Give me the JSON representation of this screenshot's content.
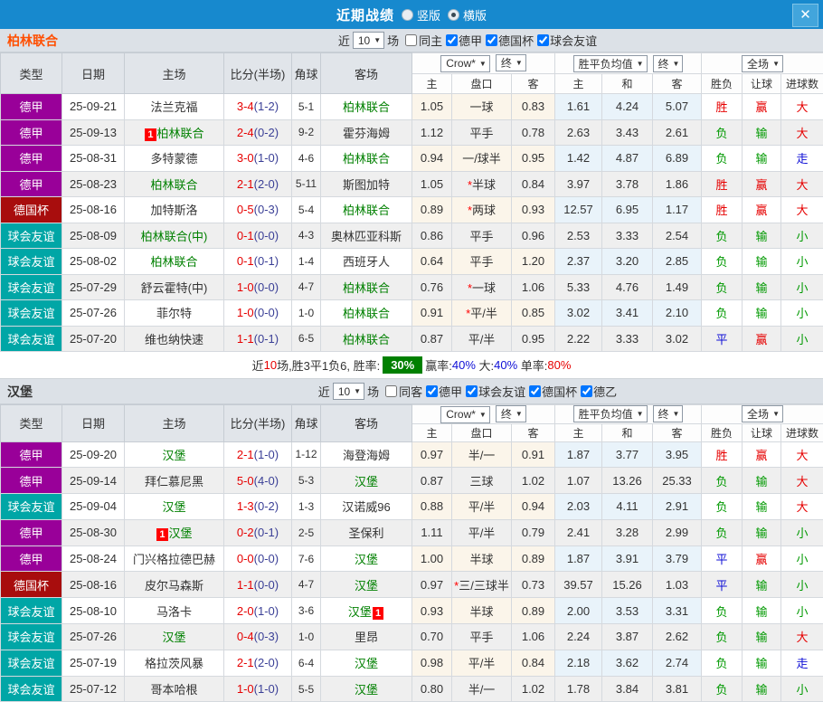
{
  "titlebar": {
    "title": "近期战绩",
    "radio_vertical": "竖版",
    "radio_horizontal": "横版",
    "selected": "横版",
    "close_glyph": "✕"
  },
  "colors": {
    "topbar_blue": "#1789CE",
    "win_red": "#E60000",
    "lose_green": "#009900",
    "draw_blue": "#0F0FD6",
    "winrate_badge_green": "#008000",
    "league_bundesliga": "#990099",
    "league_german_cup": "#A80D0D",
    "league_friendly": "#00A6A6",
    "team1_accent": "#FF4E00"
  },
  "headers": {
    "type": "类型",
    "date": "日期",
    "home": "主场",
    "score": "比分(半场)",
    "corner": "角球",
    "away": "客场",
    "odds_company": "Crow*",
    "final1": "终",
    "avg_label": "胜平负均值",
    "final2": "终",
    "scope": "全场",
    "sub": [
      "主",
      "盘口",
      "客",
      "主",
      "和",
      "客",
      "胜负",
      "让球",
      "进球数"
    ]
  },
  "sections": [
    {
      "team": "柏林联合",
      "team_color": "#FF4E00",
      "filter": {
        "near_label": "近",
        "count": "10",
        "games_label": "场",
        "same_label": "同主",
        "same_checked": false,
        "leagues": [
          {
            "label": "德甲",
            "checked": true
          },
          {
            "label": "德国杯",
            "checked": true
          },
          {
            "label": "球会友谊",
            "checked": true
          }
        ]
      },
      "rows": [
        {
          "league": "德甲",
          "league_color": "#990099",
          "date": "25-09-21",
          "home": {
            "name": "法兰克福",
            "green": false
          },
          "ft": "3-4",
          "ht": "(1-2)",
          "corner": "5-1",
          "away": {
            "name": "柏林联合",
            "green": true
          },
          "o_home": "1.05",
          "h_star": false,
          "handicap": "一球",
          "o_away": "0.83",
          "avg": [
            "1.61",
            "4.24",
            "5.07"
          ],
          "res": [
            [
              "胜",
              "r"
            ],
            [
              "赢",
              "r"
            ],
            [
              "大",
              "r"
            ]
          ]
        },
        {
          "league": "德甲",
          "league_color": "#990099",
          "date": "25-09-13",
          "home": {
            "name": "柏林联合",
            "green": true,
            "badge": "1",
            "badge_pos": "before"
          },
          "ft": "2-4",
          "ht": "(0-2)",
          "corner": "9-2",
          "away": {
            "name": "霍芬海姆",
            "green": false
          },
          "o_home": "1.12",
          "h_star": false,
          "handicap": "平手",
          "o_away": "0.78",
          "avg": [
            "2.63",
            "3.43",
            "2.61"
          ],
          "res": [
            [
              "负",
              "g"
            ],
            [
              "输",
              "g"
            ],
            [
              "大",
              "r"
            ]
          ]
        },
        {
          "league": "德甲",
          "league_color": "#990099",
          "date": "25-08-31",
          "home": {
            "name": "多特蒙德",
            "green": false
          },
          "ft": "3-0",
          "ht": "(1-0)",
          "corner": "4-6",
          "away": {
            "name": "柏林联合",
            "green": true
          },
          "o_home": "0.94",
          "h_star": false,
          "handicap": "一/球半",
          "o_away": "0.95",
          "avg": [
            "1.42",
            "4.87",
            "6.89"
          ],
          "res": [
            [
              "负",
              "g"
            ],
            [
              "输",
              "g"
            ],
            [
              "走",
              "b"
            ]
          ]
        },
        {
          "league": "德甲",
          "league_color": "#990099",
          "date": "25-08-23",
          "home": {
            "name": "柏林联合",
            "green": true
          },
          "ft": "2-1",
          "ht": "(2-0)",
          "corner": "5-11",
          "away": {
            "name": "斯图加特",
            "green": false
          },
          "o_home": "1.05",
          "h_star": true,
          "handicap": "半球",
          "o_away": "0.84",
          "avg": [
            "3.97",
            "3.78",
            "1.86"
          ],
          "res": [
            [
              "胜",
              "r"
            ],
            [
              "赢",
              "r"
            ],
            [
              "大",
              "r"
            ]
          ]
        },
        {
          "league": "德国杯",
          "league_color": "#A80D0D",
          "date": "25-08-16",
          "home": {
            "name": "加特斯洛",
            "green": false
          },
          "ft": "0-5",
          "ht": "(0-3)",
          "corner": "5-4",
          "away": {
            "name": "柏林联合",
            "green": true
          },
          "o_home": "0.89",
          "h_star": true,
          "handicap": "两球",
          "o_away": "0.93",
          "avg": [
            "12.57",
            "6.95",
            "1.17"
          ],
          "res": [
            [
              "胜",
              "r"
            ],
            [
              "赢",
              "r"
            ],
            [
              "大",
              "r"
            ]
          ]
        },
        {
          "league": "球会友谊",
          "league_color": "#00A6A6",
          "date": "25-08-09",
          "home": {
            "name": "柏林联合(中)",
            "green": true
          },
          "ft": "0-1",
          "ht": "(0-0)",
          "corner": "4-3",
          "away": {
            "name": "奥林匹亚科斯",
            "green": false
          },
          "o_home": "0.86",
          "h_star": false,
          "handicap": "平手",
          "o_away": "0.96",
          "avg": [
            "2.53",
            "3.33",
            "2.54"
          ],
          "res": [
            [
              "负",
              "g"
            ],
            [
              "输",
              "g"
            ],
            [
              "小",
              "g"
            ]
          ]
        },
        {
          "league": "球会友谊",
          "league_color": "#00A6A6",
          "date": "25-08-02",
          "home": {
            "name": "柏林联合",
            "green": true
          },
          "ft": "0-1",
          "ht": "(0-1)",
          "corner": "1-4",
          "away": {
            "name": "西班牙人",
            "green": false
          },
          "o_home": "0.64",
          "h_star": false,
          "handicap": "平手",
          "o_away": "1.20",
          "avg": [
            "2.37",
            "3.20",
            "2.85"
          ],
          "res": [
            [
              "负",
              "g"
            ],
            [
              "输",
              "g"
            ],
            [
              "小",
              "g"
            ]
          ]
        },
        {
          "league": "球会友谊",
          "league_color": "#00A6A6",
          "date": "25-07-29",
          "home": {
            "name": "舒云霍特(中)",
            "green": false
          },
          "ft": "1-0",
          "ht": "(0-0)",
          "corner": "4-7",
          "away": {
            "name": "柏林联合",
            "green": true
          },
          "o_home": "0.76",
          "h_star": true,
          "handicap": "一球",
          "o_away": "1.06",
          "avg": [
            "5.33",
            "4.76",
            "1.49"
          ],
          "res": [
            [
              "负",
              "g"
            ],
            [
              "输",
              "g"
            ],
            [
              "小",
              "g"
            ]
          ]
        },
        {
          "league": "球会友谊",
          "league_color": "#00A6A6",
          "date": "25-07-26",
          "home": {
            "name": "菲尔特",
            "green": false
          },
          "ft": "1-0",
          "ht": "(0-0)",
          "corner": "1-0",
          "away": {
            "name": "柏林联合",
            "green": true
          },
          "o_home": "0.91",
          "h_star": true,
          "handicap": "平/半",
          "o_away": "0.85",
          "avg": [
            "3.02",
            "3.41",
            "2.10"
          ],
          "res": [
            [
              "负",
              "g"
            ],
            [
              "输",
              "g"
            ],
            [
              "小",
              "g"
            ]
          ]
        },
        {
          "league": "球会友谊",
          "league_color": "#00A6A6",
          "date": "25-07-20",
          "home": {
            "name": "维也纳快速",
            "green": false
          },
          "ft": "1-1",
          "ht": "(0-1)",
          "corner": "6-5",
          "away": {
            "name": "柏林联合",
            "green": true
          },
          "o_home": "0.87",
          "h_star": false,
          "handicap": "平/半",
          "o_away": "0.95",
          "avg": [
            "2.22",
            "3.33",
            "3.02"
          ],
          "res": [
            [
              "平",
              "b"
            ],
            [
              "赢",
              "r"
            ],
            [
              "小",
              "g"
            ]
          ]
        }
      ],
      "summary": {
        "t1": "近",
        "count": "10",
        "t2": "场,胜3平1负6, 胜率:",
        "win_rate": "30%",
        "t3": "赢率:",
        "rate2": "40%",
        "t4": " 大:",
        "rate3": "40%",
        "t5": " 单率:",
        "rate4": "80%"
      }
    },
    {
      "team": "汉堡",
      "team_color": "#333333",
      "filter": {
        "near_label": "近",
        "count": "10",
        "games_label": "场",
        "same_label": "同客",
        "same_checked": false,
        "leagues": [
          {
            "label": "德甲",
            "checked": true
          },
          {
            "label": "球会友谊",
            "checked": true
          },
          {
            "label": "德国杯",
            "checked": true
          },
          {
            "label": "德乙",
            "checked": true
          }
        ]
      },
      "rows": [
        {
          "league": "德甲",
          "league_color": "#990099",
          "date": "25-09-20",
          "home": {
            "name": "汉堡",
            "green": true
          },
          "ft": "2-1",
          "ht": "(1-0)",
          "corner": "1-12",
          "away": {
            "name": "海登海姆",
            "green": false
          },
          "o_home": "0.97",
          "h_star": false,
          "handicap": "半/一",
          "o_away": "0.91",
          "avg": [
            "1.87",
            "3.77",
            "3.95"
          ],
          "res": [
            [
              "胜",
              "r"
            ],
            [
              "赢",
              "r"
            ],
            [
              "大",
              "r"
            ]
          ]
        },
        {
          "league": "德甲",
          "league_color": "#990099",
          "date": "25-09-14",
          "home": {
            "name": "拜仁慕尼黑",
            "green": false
          },
          "ft": "5-0",
          "ht": "(4-0)",
          "corner": "5-3",
          "away": {
            "name": "汉堡",
            "green": true
          },
          "o_home": "0.87",
          "h_star": false,
          "handicap": "三球",
          "o_away": "1.02",
          "avg": [
            "1.07",
            "13.26",
            "25.33"
          ],
          "res": [
            [
              "负",
              "g"
            ],
            [
              "输",
              "g"
            ],
            [
              "大",
              "r"
            ]
          ]
        },
        {
          "league": "球会友谊",
          "league_color": "#00A6A6",
          "date": "25-09-04",
          "home": {
            "name": "汉堡",
            "green": true
          },
          "ft": "1-3",
          "ht": "(0-2)",
          "corner": "1-3",
          "away": {
            "name": "汉诺威96",
            "green": false
          },
          "o_home": "0.88",
          "h_star": false,
          "handicap": "平/半",
          "o_away": "0.94",
          "avg": [
            "2.03",
            "4.11",
            "2.91"
          ],
          "res": [
            [
              "负",
              "g"
            ],
            [
              "输",
              "g"
            ],
            [
              "大",
              "r"
            ]
          ]
        },
        {
          "league": "德甲",
          "league_color": "#990099",
          "date": "25-08-30",
          "home": {
            "name": "汉堡",
            "green": true,
            "badge": "1",
            "badge_pos": "before"
          },
          "ft": "0-2",
          "ht": "(0-1)",
          "corner": "2-5",
          "away": {
            "name": "圣保利",
            "green": false
          },
          "o_home": "1.11",
          "h_star": false,
          "handicap": "平/半",
          "o_away": "0.79",
          "avg": [
            "2.41",
            "3.28",
            "2.99"
          ],
          "res": [
            [
              "负",
              "g"
            ],
            [
              "输",
              "g"
            ],
            [
              "小",
              "g"
            ]
          ]
        },
        {
          "league": "德甲",
          "league_color": "#990099",
          "date": "25-08-24",
          "home": {
            "name": "门兴格拉德巴赫",
            "green": false
          },
          "ft": "0-0",
          "ht": "(0-0)",
          "corner": "7-6",
          "away": {
            "name": "汉堡",
            "green": true
          },
          "o_home": "1.00",
          "h_star": false,
          "handicap": "半球",
          "o_away": "0.89",
          "avg": [
            "1.87",
            "3.91",
            "3.79"
          ],
          "res": [
            [
              "平",
              "b"
            ],
            [
              "赢",
              "r"
            ],
            [
              "小",
              "g"
            ]
          ]
        },
        {
          "league": "德国杯",
          "league_color": "#A80D0D",
          "date": "25-08-16",
          "home": {
            "name": "皮尔马森斯",
            "green": false
          },
          "ft": "1-1",
          "ht": "(0-0)",
          "corner": "4-7",
          "away": {
            "name": "汉堡",
            "green": true
          },
          "o_home": "0.97",
          "h_star": true,
          "handicap": "三/三球半",
          "o_away": "0.73",
          "avg": [
            "39.57",
            "15.26",
            "1.03"
          ],
          "res": [
            [
              "平",
              "b"
            ],
            [
              "输",
              "g"
            ],
            [
              "小",
              "g"
            ]
          ]
        },
        {
          "league": "球会友谊",
          "league_color": "#00A6A6",
          "date": "25-08-10",
          "home": {
            "name": "马洛卡",
            "green": false
          },
          "ft": "2-0",
          "ht": "(1-0)",
          "corner": "3-6",
          "away": {
            "name": "汉堡",
            "green": true,
            "badge": "1",
            "badge_pos": "after"
          },
          "o_home": "0.93",
          "h_star": false,
          "handicap": "半球",
          "o_away": "0.89",
          "avg": [
            "2.00",
            "3.53",
            "3.31"
          ],
          "res": [
            [
              "负",
              "g"
            ],
            [
              "输",
              "g"
            ],
            [
              "小",
              "g"
            ]
          ]
        },
        {
          "league": "球会友谊",
          "league_color": "#00A6A6",
          "date": "25-07-26",
          "home": {
            "name": "汉堡",
            "green": true
          },
          "ft": "0-4",
          "ht": "(0-3)",
          "corner": "1-0",
          "away": {
            "name": "里昂",
            "green": false
          },
          "o_home": "0.70",
          "h_star": false,
          "handicap": "平手",
          "o_away": "1.06",
          "avg": [
            "2.24",
            "3.87",
            "2.62"
          ],
          "res": [
            [
              "负",
              "g"
            ],
            [
              "输",
              "g"
            ],
            [
              "大",
              "r"
            ]
          ]
        },
        {
          "league": "球会友谊",
          "league_color": "#00A6A6",
          "date": "25-07-19",
          "home": {
            "name": "格拉茨风暴",
            "green": false
          },
          "ft": "2-1",
          "ht": "(2-0)",
          "corner": "6-4",
          "away": {
            "name": "汉堡",
            "green": true
          },
          "o_home": "0.98",
          "h_star": false,
          "handicap": "平/半",
          "o_away": "0.84",
          "avg": [
            "2.18",
            "3.62",
            "2.74"
          ],
          "res": [
            [
              "负",
              "g"
            ],
            [
              "输",
              "g"
            ],
            [
              "走",
              "b"
            ]
          ]
        },
        {
          "league": "球会友谊",
          "league_color": "#00A6A6",
          "date": "25-07-12",
          "home": {
            "name": "哥本哈根",
            "green": false
          },
          "ft": "1-0",
          "ht": "(1-0)",
          "corner": "5-5",
          "away": {
            "name": "汉堡",
            "green": true
          },
          "o_home": "0.80",
          "h_star": false,
          "handicap": "半/一",
          "o_away": "1.02",
          "avg": [
            "1.78",
            "3.84",
            "3.81"
          ],
          "res": [
            [
              "负",
              "g"
            ],
            [
              "输",
              "g"
            ],
            [
              "小",
              "g"
            ]
          ]
        }
      ]
    }
  ]
}
